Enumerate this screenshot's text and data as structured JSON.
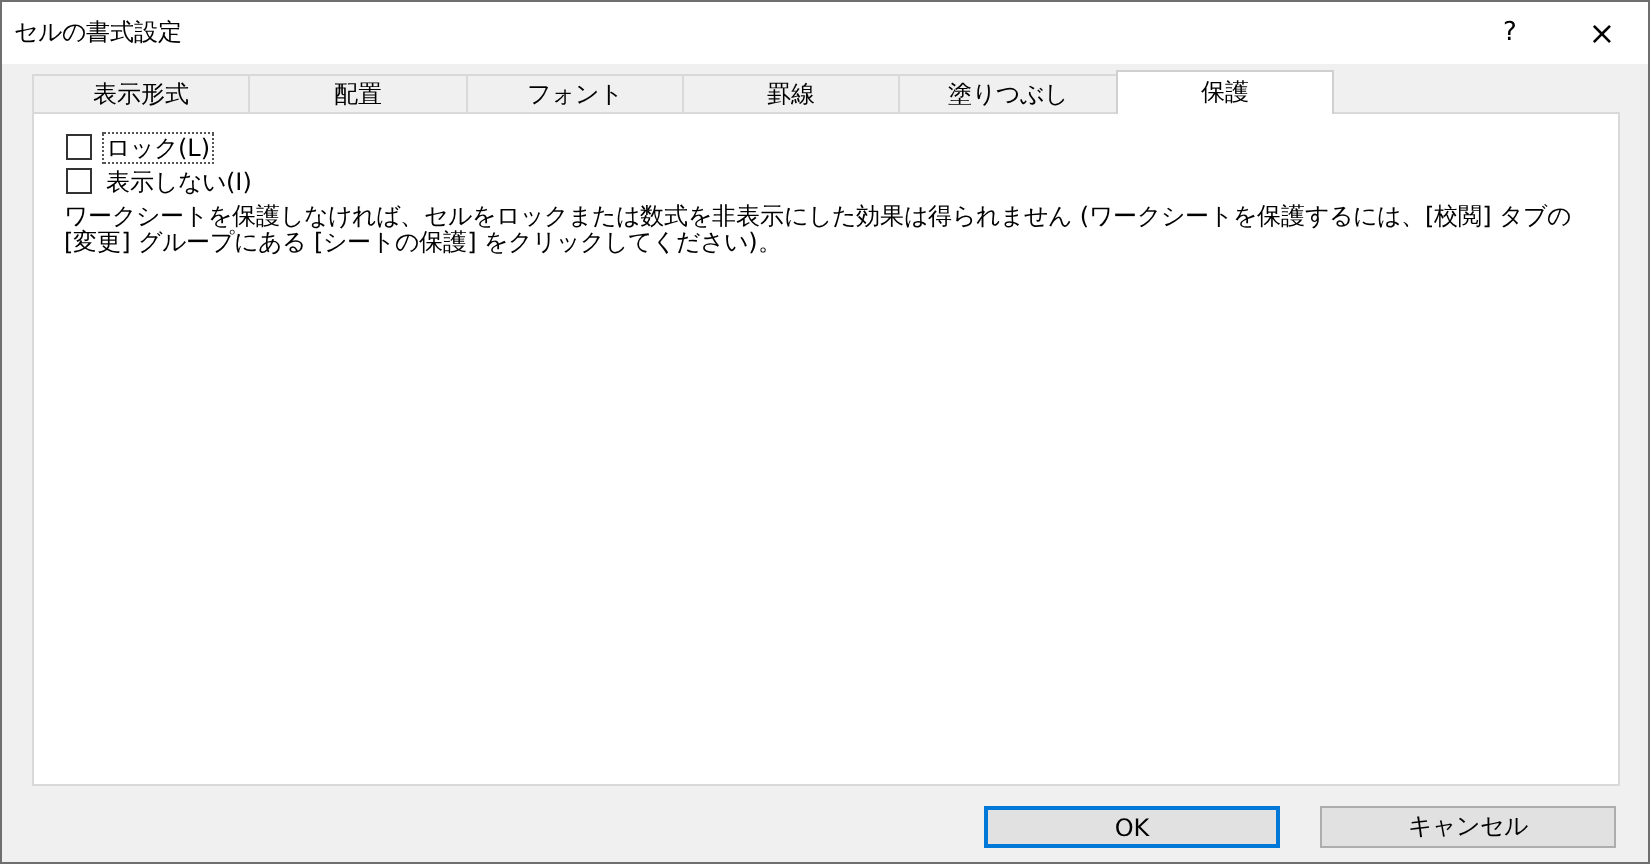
{
  "window": {
    "title": "セルの書式設定",
    "help": "?",
    "close": "×"
  },
  "tabs": [
    {
      "label": "表示形式",
      "selected": false
    },
    {
      "label": "配置",
      "selected": false
    },
    {
      "label": "フォント",
      "selected": false
    },
    {
      "label": "罫線",
      "selected": false
    },
    {
      "label": "塗りつぶし",
      "selected": false
    },
    {
      "label": "保護",
      "selected": true
    }
  ],
  "options": [
    {
      "label": "ロック(L)",
      "checked": false,
      "focused": true
    },
    {
      "label": "表示しない(I)",
      "checked": false,
      "focused": false
    }
  ],
  "note": "ワークシートを保護しなければ、セルをロックまたは数式を非表示にした効果は得られません (ワークシートを保護するには、[校閲] タブの [変更] グループにある [シートの保護] をクリックしてください)。",
  "buttons": [
    {
      "label": "OK",
      "default": true
    },
    {
      "label": "キャンセル",
      "default": false
    }
  ]
}
